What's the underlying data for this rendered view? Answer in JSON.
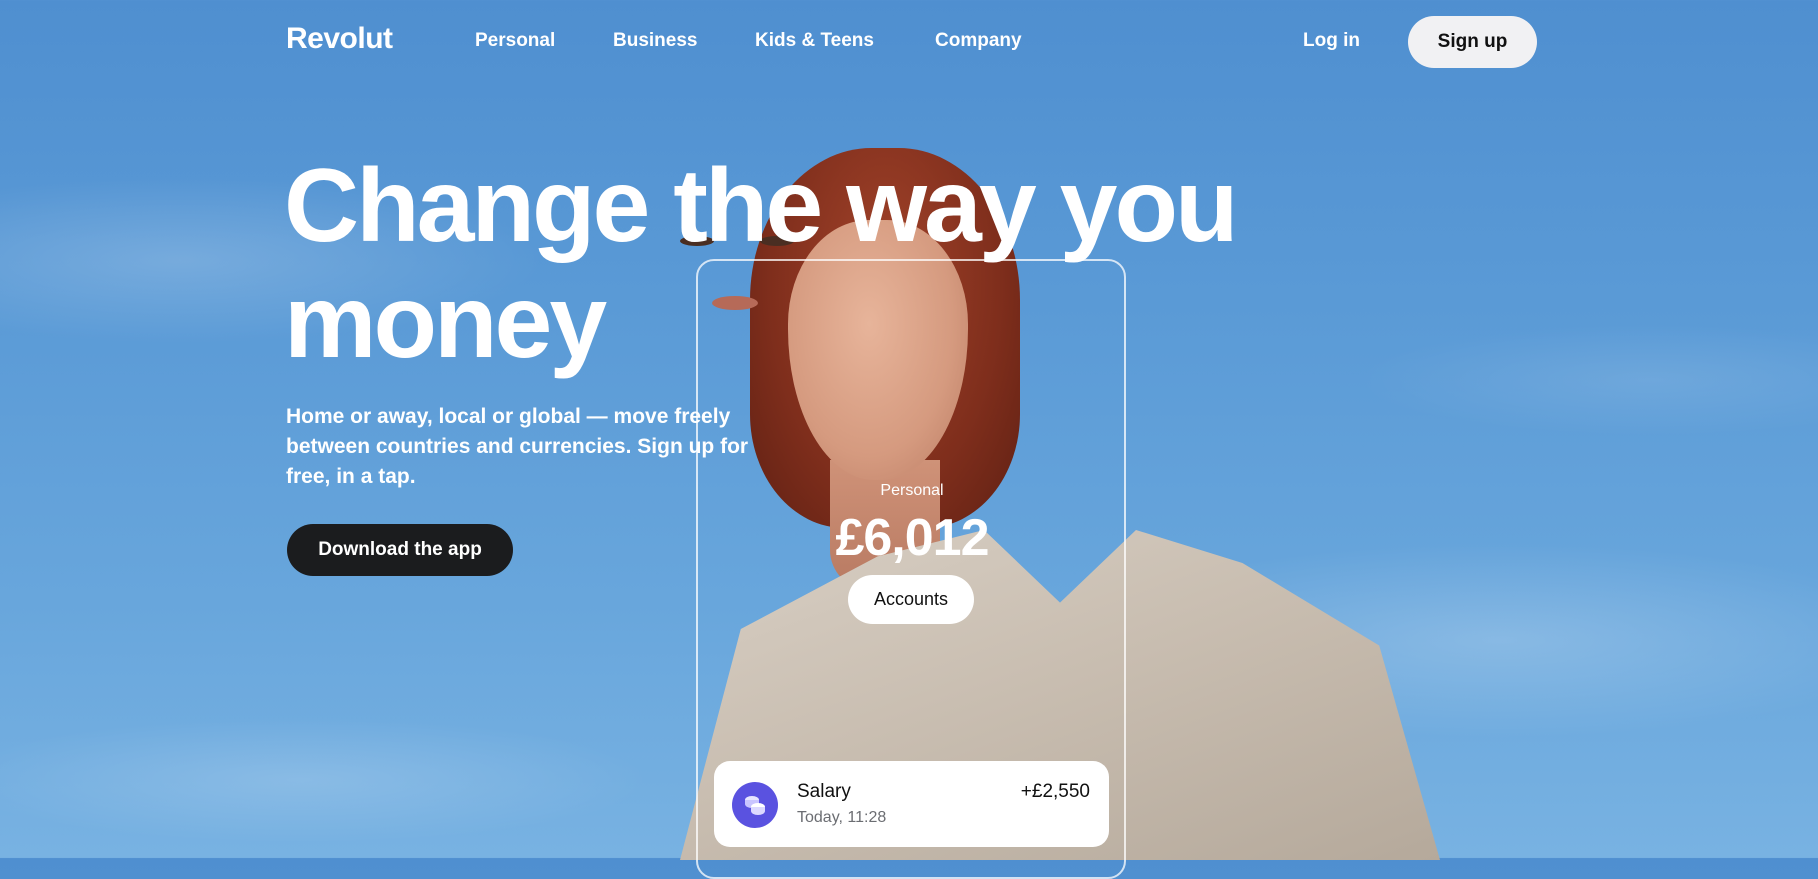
{
  "brand": {
    "logo": "Revolut"
  },
  "nav": {
    "links": [
      "Personal",
      "Business",
      "Kids & Teens",
      "Company"
    ],
    "login": "Log in",
    "signup": "Sign up"
  },
  "hero": {
    "headline_line1": "Change the way you",
    "headline_line2": "money",
    "subcopy": "Home or away, local or global — move freely between countries and currencies. Sign up for free, in a tap.",
    "cta": "Download the app"
  },
  "account_card": {
    "label": "Personal",
    "balance": "£6,012",
    "button": "Accounts"
  },
  "transaction": {
    "icon": "coins-icon",
    "title": "Salary",
    "time": "Today, 11:28",
    "amount": "+£2,550"
  },
  "colors": {
    "sky": "#5a9ad6",
    "cta_dark": "#1b1c1e",
    "accent_purple": "#5a52e0"
  }
}
